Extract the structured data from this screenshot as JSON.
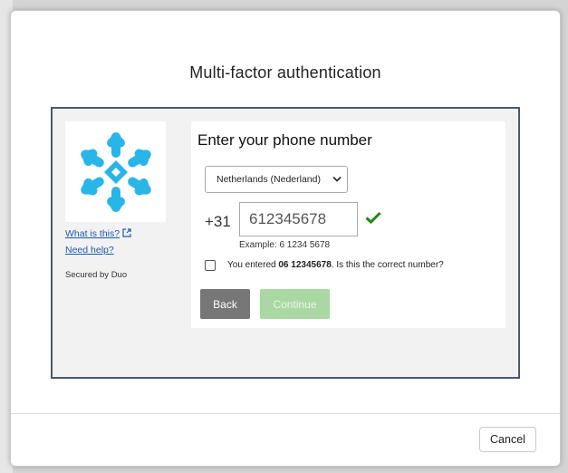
{
  "modal": {
    "title": "Multi-factor authentication",
    "cancel_label": "Cancel"
  },
  "sidebar": {
    "logo_icon": "snowflake-logo-icon",
    "logo_color": "#29b5e8",
    "what_is_this": "What is this?",
    "need_help": "Need help?",
    "secured_by": "Secured by Duo"
  },
  "enroll": {
    "title": "Enter your phone number",
    "country_selected": "Netherlands (Nederland)",
    "dial_code": "+31",
    "phone_value": "612345678",
    "example": "Example: 6 1234 5678",
    "confirm_prefix": "You entered ",
    "confirm_number": "06 12345678",
    "confirm_suffix": ". Is this the correct number?",
    "back_label": "Back",
    "continue_label": "Continue",
    "valid_color": "#1a8a1a"
  }
}
